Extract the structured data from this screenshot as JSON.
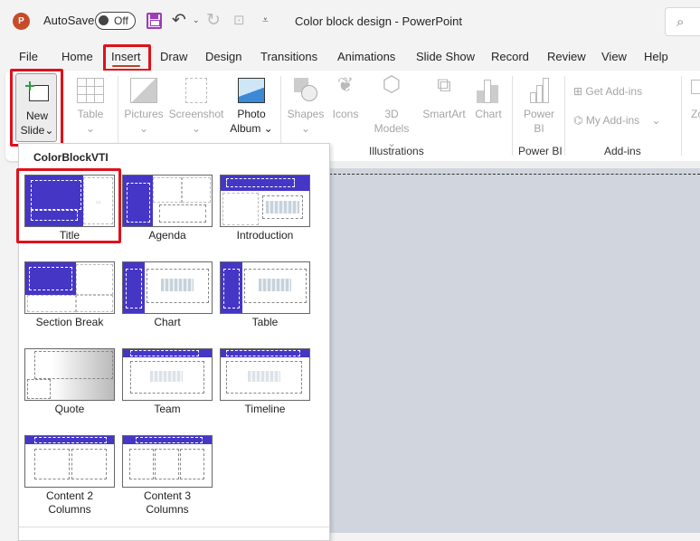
{
  "titlebar": {
    "app_logo": "P",
    "autosave_label": "AutoSave",
    "autosave_state": "Off",
    "document_title": "Color block design  -  PowerPoint",
    "icons": [
      "save-icon",
      "undo-icon",
      "undo-dropdown-icon",
      "redo-icon",
      "present-icon",
      "customize-qat-icon",
      "search-icon"
    ]
  },
  "tabs": [
    {
      "label": "File"
    },
    {
      "label": "Home"
    },
    {
      "label": "Insert",
      "active": true
    },
    {
      "label": "Draw"
    },
    {
      "label": "Design"
    },
    {
      "label": "Transitions"
    },
    {
      "label": "Animations"
    },
    {
      "label": "Slide Show"
    },
    {
      "label": "Record"
    },
    {
      "label": "Review"
    },
    {
      "label": "View"
    },
    {
      "label": "Help"
    }
  ],
  "ribbon": {
    "new_slide": {
      "line1": "New",
      "line2": "Slide",
      "caret": "⌄"
    },
    "table": "Table",
    "pictures": "Pictures",
    "screenshot": "Screenshot",
    "photo_album": {
      "line1": "Photo",
      "line2": "Album"
    },
    "shapes": "Shapes",
    "icons": "Icons",
    "models3d": {
      "line1": "3D",
      "line2": "Models"
    },
    "smartart": "SmartArt",
    "chart": "Chart",
    "powerbi": {
      "line1": "Power",
      "line2": "BI"
    },
    "get_addins": "Get Add-ins",
    "my_addins": "My Add-ins",
    "zoom_partial": "Zo",
    "groups": {
      "illustrations": "Illustrations",
      "powerbi": "Power BI",
      "addins": "Add-ins"
    }
  },
  "dropdown": {
    "header": "ColorBlockVTI",
    "layouts": [
      {
        "label": "Title",
        "selected": true
      },
      {
        "label": "Agenda"
      },
      {
        "label": "Introduction"
      },
      {
        "label": "Section Break"
      },
      {
        "label": "Chart"
      },
      {
        "label": "Table"
      },
      {
        "label": "Quote"
      },
      {
        "label": "Team"
      },
      {
        "label": "Timeline"
      },
      {
        "label": "Content 2 Columns"
      },
      {
        "label": "Content 3 Columns"
      }
    ]
  },
  "colors": {
    "accent_fill": "#4536c6",
    "highlight": "#e0101b",
    "tab_underline": "#b7472a"
  }
}
